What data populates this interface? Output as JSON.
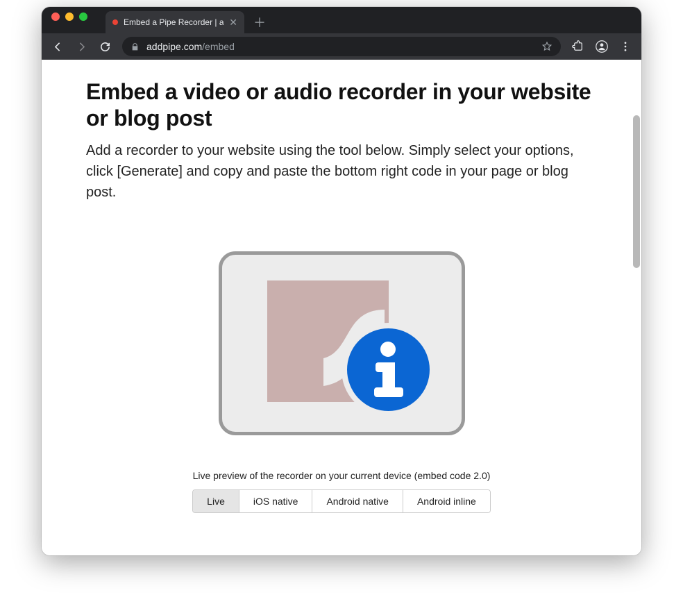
{
  "browser": {
    "tab_title": "Embed a Pipe Recorder | addpi",
    "url_domain": "addpipe.com",
    "url_path": "/embed"
  },
  "page": {
    "title": "Embed a video or audio recorder in your website or blog post",
    "description": "Add a recorder to your website using the tool below. Simply select your options, click [Generate] and copy and paste the bottom right code in your page or blog post."
  },
  "preview": {
    "caption": "Live preview of the recorder on your current device (embed code 2.0)",
    "tabs": [
      {
        "label": "Live",
        "active": true
      },
      {
        "label": "iOS native",
        "active": false
      },
      {
        "label": "Android native",
        "active": false
      },
      {
        "label": "Android inline",
        "active": false
      }
    ]
  }
}
